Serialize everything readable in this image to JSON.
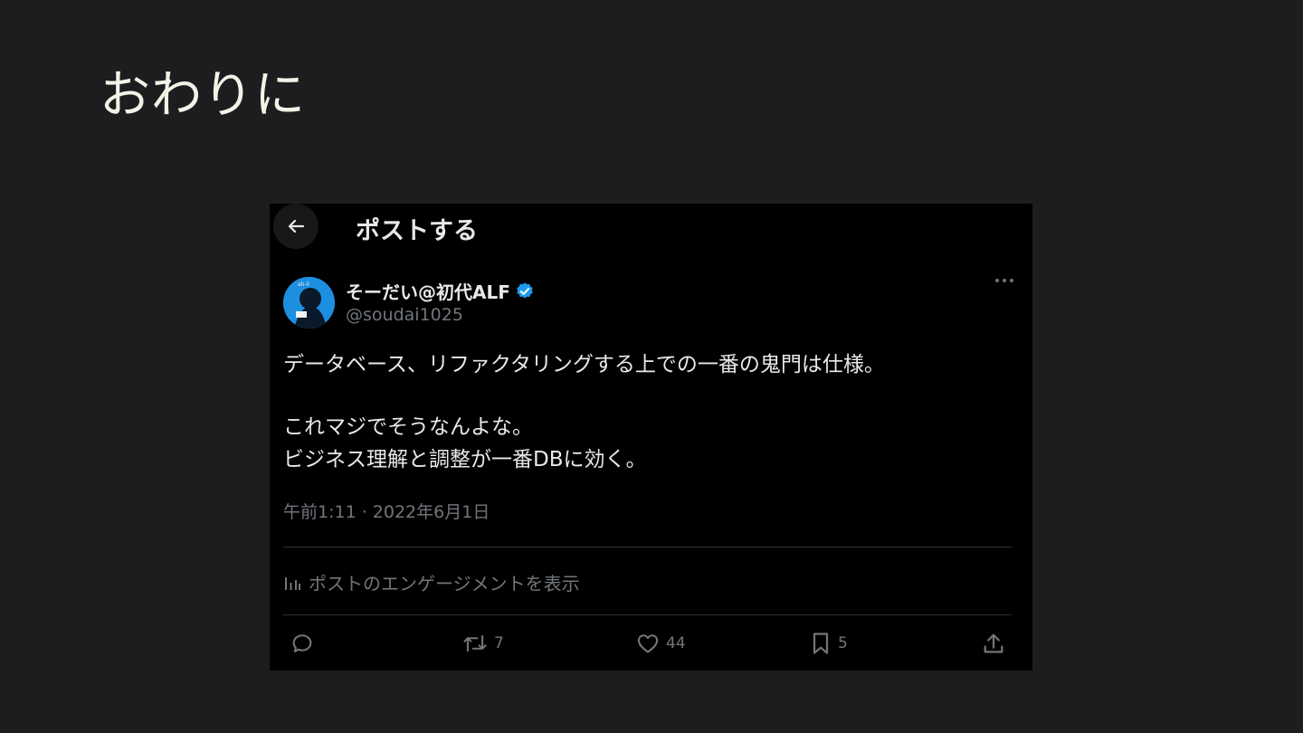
{
  "slide": {
    "title": "おわりに"
  },
  "header": {
    "title": "ポストする"
  },
  "author": {
    "name": "そーだい@初代ALF",
    "handle": "@soudai1025"
  },
  "post": {
    "lines": [
      "データベース、リファクタリングする上での一番の鬼門は仕様。",
      "",
      "これマジでそうなんよな。",
      "ビジネス理解と調整が一番DBに効く。"
    ],
    "timestamp": "午前1:11 · 2022年6月1日"
  },
  "engagement_label": "ポストのエンゲージメントを表示",
  "actions": {
    "retweets": "7",
    "likes": "44",
    "bookmarks": "5"
  },
  "icons": [
    "back-arrow-icon",
    "verified-badge-icon",
    "more-icon",
    "analytics-icon",
    "reply-icon",
    "retweet-icon",
    "like-icon",
    "bookmark-icon",
    "share-icon"
  ],
  "colors": {
    "background": "#1c1d1f",
    "card": "#000000",
    "text": "#e7e9ea",
    "muted": "#71767b",
    "verified": "#1d9bf0"
  }
}
